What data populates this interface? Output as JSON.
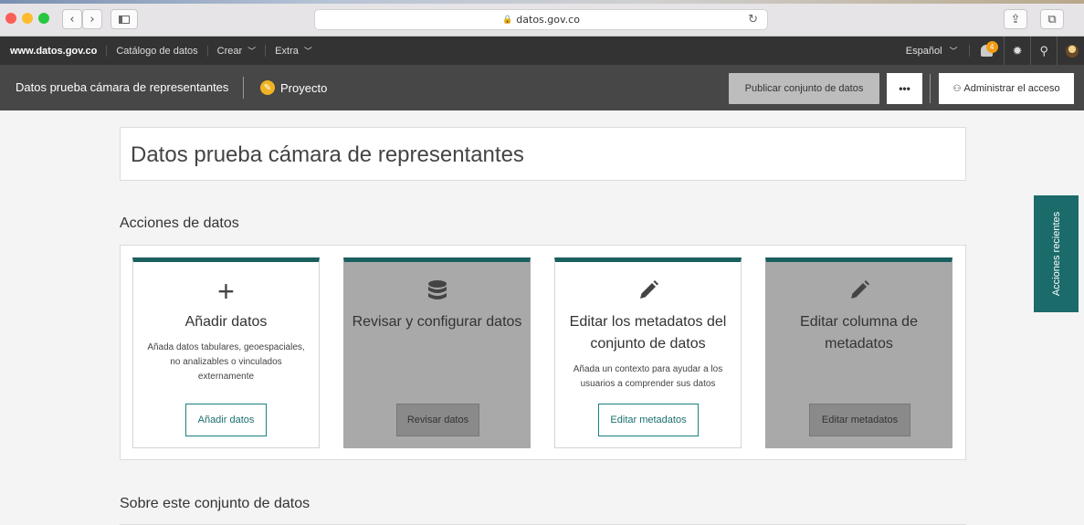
{
  "browser": {
    "url": "datos.gov.co"
  },
  "topnav": {
    "brand": "www.datos.gov.co",
    "items": [
      {
        "label": "Catálogo de datos"
      },
      {
        "label": "Crear"
      },
      {
        "label": "Extra"
      }
    ],
    "language": "Español",
    "notification_count": "4"
  },
  "dataset_bar": {
    "title": "Datos prueba cámara de representantes",
    "status": "Proyecto",
    "publish_label": "Publicar conjunto de datos",
    "more_label": "•••",
    "manage_access_label": "Administrar el acceso"
  },
  "main": {
    "title": "Datos prueba cámara de representantes",
    "actions_heading": "Acciones de datos",
    "about_heading": "Sobre este conjunto de datos",
    "cards": [
      {
        "title": "Añadir datos",
        "description": "Añada datos tabulares, geoespaciales, no analizables o vinculados externamente",
        "button": "Añadir datos",
        "enabled": true,
        "icon": "plus-icon"
      },
      {
        "title": "Revisar y configurar datos",
        "description": "",
        "button": "Revisar datos",
        "enabled": false,
        "icon": "database-icon"
      },
      {
        "title": "Editar los metadatos del conjunto de datos",
        "description": "Añada un contexto para ayudar a los usuarios a comprender sus datos",
        "button": "Editar metadatos",
        "enabled": true,
        "icon": "pencil-icon"
      },
      {
        "title": "Editar columna de metadatos",
        "description": "",
        "button": "Editar metadatos",
        "enabled": false,
        "icon": "pencil-icon"
      }
    ]
  },
  "side_tab": {
    "label": "Acciones recientes"
  },
  "colors": {
    "accent": "#1b6b6b",
    "nav_bg": "#333333",
    "dataset_bar_bg": "#474747",
    "status_yellow": "#f0b323"
  }
}
